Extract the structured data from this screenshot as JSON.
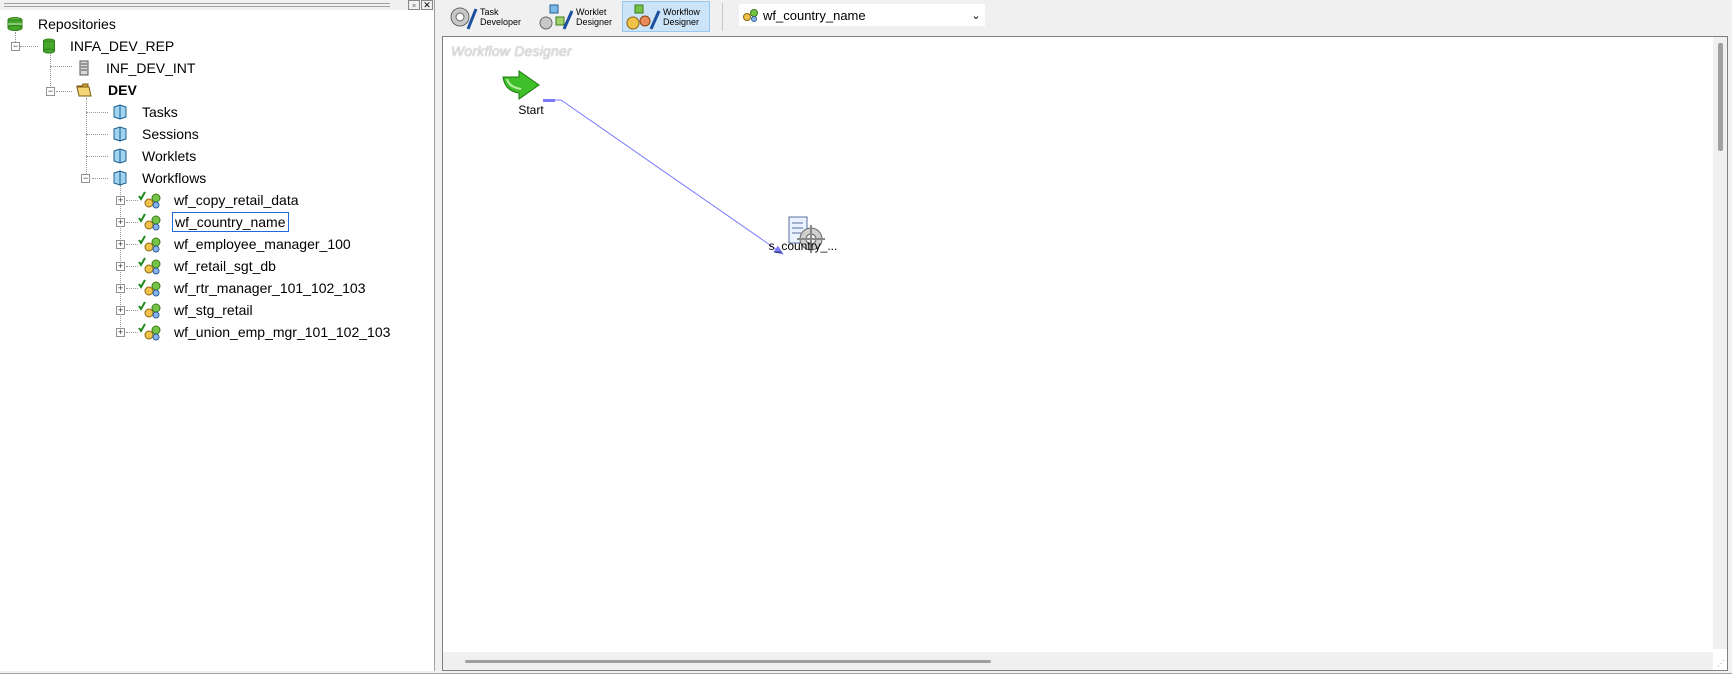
{
  "navigator": {
    "root": "Repositories",
    "repository": "INFA_DEV_REP",
    "integration_service": "INF_DEV_INT",
    "folder": "DEV",
    "folder_items": [
      "Tasks",
      "Sessions",
      "Worklets",
      "Workflows"
    ],
    "workflows": [
      "wf_copy_retail_data",
      "wf_country_name",
      "wf_employee_manager_100",
      "wf_retail_sgt_db",
      "wf_rtr_manager_101_102_103",
      "wf_stg_retail",
      "wf_union_emp_mgr_101_102_103"
    ],
    "selected_workflow": "wf_country_name"
  },
  "toolbar": {
    "task_developer": "Task\nDeveloper",
    "worklet_designer": "Worklet\nDesigner",
    "workflow_designer": "Workflow\nDesigner",
    "active_tool": "Workflow Designer",
    "workflow_combo": "wf_country_name"
  },
  "designer": {
    "title": "Workflow Designer",
    "start_label": "Start",
    "session_label": "s_country_..."
  },
  "colors": {
    "link_line": "#7b7bff",
    "selection_border": "#1e6ad6",
    "active_tool_bg": "#cce4f7"
  }
}
